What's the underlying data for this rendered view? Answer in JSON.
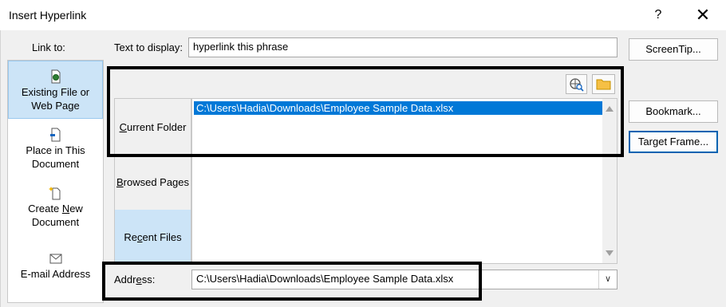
{
  "window": {
    "title": "Insert Hyperlink",
    "help_label": "?",
    "close_label": "✕"
  },
  "link_to": {
    "label": "Link to:",
    "items": [
      {
        "line1": "Existing File or",
        "line2": "Web Page",
        "icon": "existing-file-icon",
        "selected": true
      },
      {
        "line1": "Place in This",
        "line2": "Document",
        "icon": "place-in-document-icon",
        "selected": false
      },
      {
        "line1": "Create New",
        "line2": "Document",
        "icon": "new-document-icon",
        "selected": false
      },
      {
        "line1": "E-mail Address",
        "line2": "",
        "icon": "email-icon",
        "selected": false
      }
    ]
  },
  "text_to_display": {
    "label": "Text to display:",
    "value": "hyperlink this phrase"
  },
  "buttons": {
    "screentip": "ScreenTip...",
    "bookmark": "Bookmark...",
    "target_frame": "Target Frame..."
  },
  "toolbar": {
    "browse_web_icon": "browse-web-icon",
    "browse_file_icon": "browse-file-icon"
  },
  "look_in_tabs": [
    {
      "label": "Current Folder",
      "selected": false
    },
    {
      "label": "Browsed Pages",
      "selected": false
    },
    {
      "label": "Recent Files",
      "selected": true
    }
  ],
  "file_list": {
    "items": [
      "C:\\Users\\Hadia\\Downloads\\Employee Sample Data.xlsx"
    ]
  },
  "address": {
    "label": "Address:",
    "value": "C:\\Users\\Hadia\\Downloads\\Employee Sample Data.xlsx"
  },
  "colors": {
    "selection": "#0078d7",
    "nav_selected": "#cce4f7",
    "highlight_box": "#000000"
  }
}
